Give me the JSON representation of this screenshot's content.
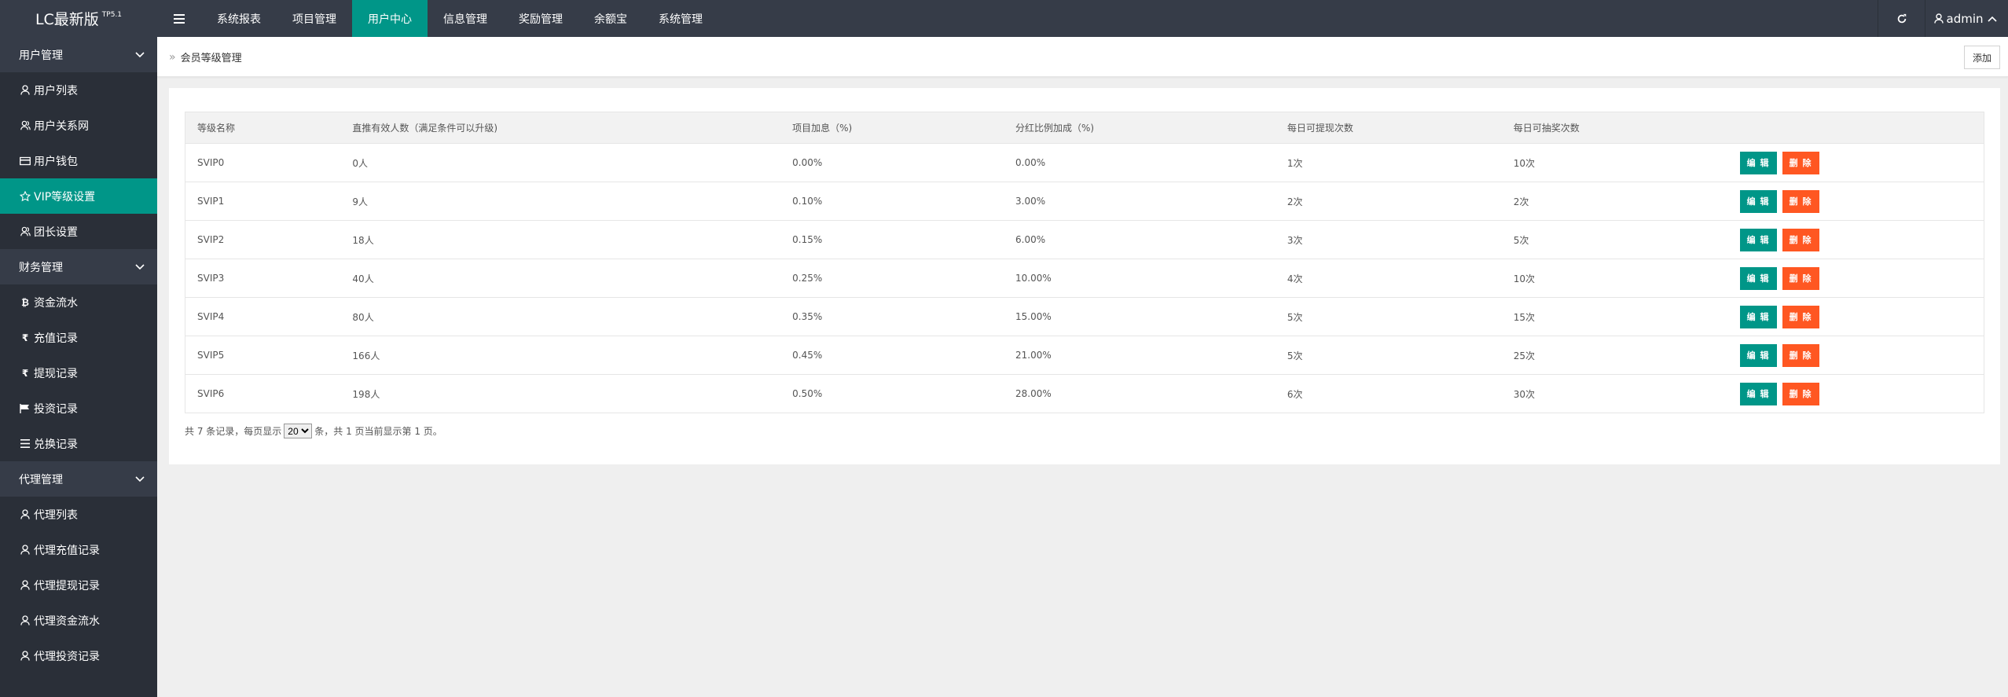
{
  "app": {
    "name": "LC最新版",
    "version": "TP5.1"
  },
  "topnav": [
    "系统报表",
    "项目管理",
    "用户中心",
    "信息管理",
    "奖励管理",
    "余额宝",
    "系统管理"
  ],
  "topnav_active": 2,
  "user": {
    "name": "admin"
  },
  "sidebar": {
    "groups": [
      {
        "label": "用户管理",
        "items": [
          {
            "label": "用户列表",
            "icon": "user-icon"
          },
          {
            "label": "用户关系网",
            "icon": "users-icon"
          },
          {
            "label": "用户钱包",
            "icon": "wallet-icon"
          },
          {
            "label": "VIP等级设置",
            "icon": "star-icon",
            "active": true
          },
          {
            "label": "团长设置",
            "icon": "users-icon"
          }
        ]
      },
      {
        "label": "财务管理",
        "items": [
          {
            "label": "资金流水",
            "icon": "bitcoin-icon"
          },
          {
            "label": "充值记录",
            "icon": "rupee-icon"
          },
          {
            "label": "提现记录",
            "icon": "rupee-icon"
          },
          {
            "label": "投资记录",
            "icon": "flag-icon"
          },
          {
            "label": "兑换记录",
            "icon": "list-icon"
          }
        ]
      },
      {
        "label": "代理管理",
        "items": [
          {
            "label": "代理列表",
            "icon": "user-icon"
          },
          {
            "label": "代理充值记录",
            "icon": "user-icon"
          },
          {
            "label": "代理提现记录",
            "icon": "user-icon"
          },
          {
            "label": "代理资金流水",
            "icon": "user-icon"
          },
          {
            "label": "代理投资记录",
            "icon": "user-icon"
          }
        ]
      }
    ]
  },
  "breadcrumb": {
    "title": "会员等级管理",
    "add_label": "添加"
  },
  "table": {
    "headers": [
      "等级名称",
      "直推有效人数（满足条件可以升级)",
      "项目加息（%)",
      "分红比例加成（%)",
      "每日可提现次数",
      "每日可抽奖次数",
      ""
    ],
    "rows": [
      [
        "SVIP0",
        "0人",
        "0.00%",
        "0.00%",
        "1次",
        "10次"
      ],
      [
        "SVIP1",
        "9人",
        "0.10%",
        "3.00%",
        "2次",
        "2次"
      ],
      [
        "SVIP2",
        "18人",
        "0.15%",
        "6.00%",
        "3次",
        "5次"
      ],
      [
        "SVIP3",
        "40人",
        "0.25%",
        "10.00%",
        "4次",
        "10次"
      ],
      [
        "SVIP4",
        "80人",
        "0.35%",
        "15.00%",
        "5次",
        "15次"
      ],
      [
        "SVIP5",
        "166人",
        "0.45%",
        "21.00%",
        "5次",
        "25次"
      ],
      [
        "SVIP6",
        "198人",
        "0.50%",
        "28.00%",
        "6次",
        "30次"
      ]
    ],
    "edit_label": "编 辑",
    "delete_label": "删 除"
  },
  "pager": {
    "prefix": "共 7 条记录，每页显示",
    "page_size": "20",
    "suffix": "条，共 1 页当前显示第 1 页。"
  },
  "colors": {
    "header_bg": "#363c48",
    "sidebar_bg": "#2a2f38",
    "accent": "#009688",
    "danger": "#ff5722"
  }
}
